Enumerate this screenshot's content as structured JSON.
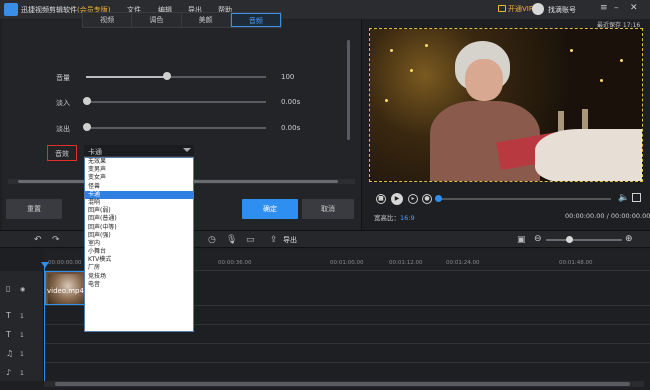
{
  "app": {
    "title": "迅捷视频剪辑软件",
    "edition": "(会员专版)",
    "menu": [
      "文件",
      "编辑",
      "导出",
      "帮助"
    ],
    "vip": "开通VIP",
    "account": "找滴账号",
    "autosave": "最近保存 17:16"
  },
  "panel": {
    "tabs": [
      "视频",
      "调色",
      "美颜",
      "音频"
    ],
    "active_tab": 3,
    "volume_label": "音量",
    "volume_value": "100",
    "volume_level": 0.45,
    "fadein_label": "淡入",
    "fadein_value": "0.00s",
    "fadeout_label": "淡出",
    "fadeout_value": "0.00s",
    "effect_label": "音效",
    "effect_selected": "卡通",
    "effect_options": [
      "无效果",
      "变男声",
      "变女声",
      "怪兽",
      "卡通",
      "混响",
      "回声(弱)",
      "回声(普通)",
      "回声(中等)",
      "回声(强)",
      "室内",
      "小舞台",
      "KTV模式",
      "厂房",
      "竞技场",
      "电音"
    ],
    "effect_selected_index": 4,
    "reset": "重置",
    "ok": "确定",
    "cancel": "取消"
  },
  "player": {
    "ratio_label": "宽高比：",
    "ratio_value": "16:9",
    "time": "00:00:00.00 / 00:00:00.00",
    "progress": 0.0
  },
  "toolbar": {
    "export": "导出"
  },
  "timeline": {
    "ticks": [
      "00:00:00.00",
      "00:00:36.00",
      "00:01:00.00",
      "00:01:12.00",
      "00:01:24.00",
      "00:01:48.00"
    ],
    "clip_name": "video.mp4"
  },
  "colors": {
    "accent": "#2f8ff0",
    "vip": "#f0b43c",
    "highlight_box": "#e0302c"
  }
}
